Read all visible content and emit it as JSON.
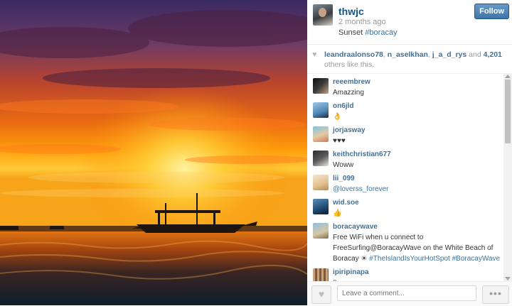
{
  "post": {
    "username": "thwjc",
    "time_ago": "2 months ago",
    "caption_text": "Sunset ",
    "caption_tag": "#boracay",
    "follow_label": "Follow"
  },
  "likes": {
    "users": [
      "leandraalonso78",
      "n_aselkhan",
      "j_a_d_rys"
    ],
    "and_text": " and ",
    "count_text": "4,201",
    "suffix": " others like this."
  },
  "comments": [
    {
      "user": "reeembrew",
      "text": "Amazzing"
    },
    {
      "user": "on6jld",
      "text": "👌"
    },
    {
      "user": "jorjasway",
      "text": "♥♥♥"
    },
    {
      "user": "keithchristian677",
      "text": "Woww"
    },
    {
      "user": "lii_099",
      "text": "@loverss_forever"
    },
    {
      "user": "wid.soe",
      "text": "👍"
    },
    {
      "user": "boracaywave",
      "text_plain": "Free WiFi when u connect to FreeSurfing@BoracayWave on the White Beach of Boracay ☀ ",
      "tags": "#TheIslandIsYourHotSpot #BoracayWave"
    },
    {
      "user": "ipiripinapa",
      "text": "▯"
    }
  ],
  "footer": {
    "comment_placeholder": "Leave a comment...",
    "more_label": "•••"
  },
  "icons": {
    "heart": "heart-icon",
    "like_button": "heart-icon",
    "more": "ellipsis-icon"
  },
  "colors": {
    "link": "#3f729b",
    "username": "#125688",
    "follow_button": "#3e76a8"
  }
}
